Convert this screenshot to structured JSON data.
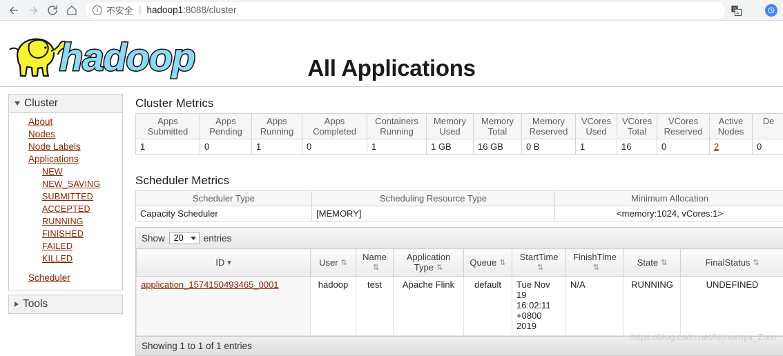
{
  "browser": {
    "back_icon": "arrow-left-icon",
    "forward_icon": "arrow-right-icon",
    "reload_icon": "reload-icon",
    "home_icon": "home-icon",
    "info_glyph": "i",
    "security_label": "不安全",
    "separator": "|",
    "url_host": "hadoop1",
    "url_rest": ":8088/cluster",
    "translate_icon": "translate-icon",
    "star_icon": "★",
    "profile_icon": "profile-icon"
  },
  "header": {
    "logo_alt": "hadoop",
    "title": "All Applications"
  },
  "sidebar": {
    "cluster": {
      "label": "Cluster",
      "expanded": true,
      "items": [
        {
          "label": "About"
        },
        {
          "label": "Nodes"
        },
        {
          "label": "Node Labels"
        },
        {
          "label": "Applications"
        }
      ],
      "app_states": [
        {
          "label": "NEW"
        },
        {
          "label": "NEW_SAVING"
        },
        {
          "label": "SUBMITTED"
        },
        {
          "label": "ACCEPTED"
        },
        {
          "label": "RUNNING"
        },
        {
          "label": "FINISHED"
        },
        {
          "label": "FAILED"
        },
        {
          "label": "KILLED"
        }
      ],
      "scheduler_label": "Scheduler"
    },
    "tools": {
      "label": "Tools",
      "expanded": false
    }
  },
  "cluster_metrics": {
    "title": "Cluster Metrics",
    "headers": [
      "Apps Submitted",
      "Apps Pending",
      "Apps Running",
      "Apps Completed",
      "Containers Running",
      "Memory Used",
      "Memory Total",
      "Memory Reserved",
      "VCores Used",
      "VCores Total",
      "VCores Reserved",
      "Active Nodes",
      "De"
    ],
    "values": [
      "1",
      "0",
      "1",
      "0",
      "1",
      "1 GB",
      "16 GB",
      "0 B",
      "1",
      "16",
      "0",
      "2",
      "0"
    ],
    "link_indices": [
      11
    ]
  },
  "scheduler_metrics": {
    "title": "Scheduler Metrics",
    "headers": [
      "Scheduler Type",
      "Scheduling Resource Type",
      "Minimum Allocation"
    ],
    "row": [
      "Capacity Scheduler",
      "[MEMORY]",
      "<memory:1024, vCores:1>"
    ]
  },
  "apps_table": {
    "show_label": "Show",
    "page_size": "20",
    "entries_label": "entries",
    "columns": [
      {
        "label": "ID",
        "sort": "desc"
      },
      {
        "label": "User",
        "sort": "both"
      },
      {
        "label": "Name",
        "sort": "both"
      },
      {
        "label": "Application Type",
        "sort": "both"
      },
      {
        "label": "Queue",
        "sort": "both"
      },
      {
        "label": "StartTime",
        "sort": "both"
      },
      {
        "label": "FinishTime",
        "sort": "both"
      },
      {
        "label": "State",
        "sort": "both"
      },
      {
        "label": "FinalStatus",
        "sort": "both"
      }
    ],
    "rows": [
      {
        "id": "application_1574150493465_0001",
        "user": "hadoop",
        "name": "test",
        "application_type": "Apache Flink",
        "queue": "default",
        "start_time": "Tue Nov 19 16:02:11 +0800 2019",
        "finish_time": "N/A",
        "state": "RUNNING",
        "final_status": "UNDEFINED"
      }
    ],
    "footer": "Showing 1 to 1 of 1 entries"
  },
  "watermark": "https://blog.csdn.net/Nonoroya_Zoro",
  "colors": {
    "link": "#8b2500",
    "chrome_bg": "#f1f3f4",
    "header_bg": "#f6f6f6",
    "accent_blue": "#4285f4"
  }
}
